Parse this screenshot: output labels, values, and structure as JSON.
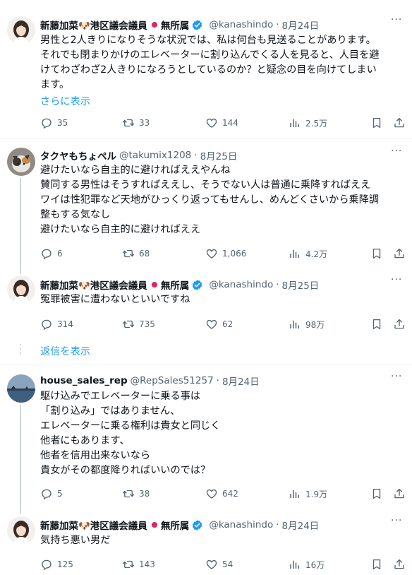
{
  "colors": {
    "accent": "#1d9bf0",
    "muted": "#536471",
    "text": "#0f1419",
    "verified": "#1d9bf0",
    "red_ball": "#e0245e"
  },
  "tweets": [
    {
      "name": "新藤加菜🐶港区議会議員",
      "affiliation": "無所属",
      "verified": true,
      "handle": "@kanashindo",
      "date": "8月24日",
      "lines": [
        "男性と2人きりになりそうな状況では、私は何台も見送ることがあります。",
        "それでも閉まりかけのエレベーターに割り込んでくる人を見ると、人目を避",
        "けてわざわざ2人きりになろうとしているのか？と疑念の目を向けてしまい",
        "ます。"
      ],
      "show_more": "さらに表示",
      "replies": "35",
      "retweets": "33",
      "likes": "144",
      "views": "2.5万"
    },
    {
      "name": "タクヤもちょペル",
      "handle": "@takumix1208",
      "date": "8月25日",
      "lines": [
        "避けたいなら自主的に避ければええやんね",
        "賛同する男性はそうすればええし、そうでない人は普通に乗降すればええ",
        "ワイは性犯罪など天地がひっくり返ってもせんし、めんどくさいから乗降調",
        "整もする気なし",
        "避けたいなら自主的に避ければええ"
      ],
      "replies": "6",
      "retweets": "68",
      "likes": "1,066",
      "views": "4.2万"
    },
    {
      "name": "新藤加菜🐶港区議会議員",
      "affiliation": "無所属",
      "verified": true,
      "handle": "@kanashindo",
      "date": "8月25日",
      "lines": [
        "冤罪被害に遭わないといいですね"
      ],
      "replies": "314",
      "retweets": "735",
      "likes": "62",
      "views": "98万"
    },
    {
      "name": "house_sales_rep",
      "handle": "@RepSales51257",
      "date": "8月24日",
      "lines": [
        "駆け込みでエレベーターに乗る事は",
        "「割り込み」ではありません、",
        "エレベーターに乗る権利は貴女と同じく",
        "他者にもあります、",
        "他者を信用出来ないなら",
        "貴女がその都度降りればいいのでは？"
      ],
      "replies": "5",
      "retweets": "38",
      "likes": "642",
      "views": "1.9万"
    },
    {
      "name": "新藤加菜🐶港区議会議員",
      "affiliation": "無所属",
      "verified": true,
      "handle": "@kanashindo",
      "date": "8月24日",
      "lines": [
        "気持ち悪い男だ"
      ],
      "replies": "125",
      "retweets": "143",
      "likes": "54",
      "views": "16万"
    }
  ],
  "show_replies": "返信を表示",
  "icons": [
    "reply-icon",
    "retweet-icon",
    "like-icon",
    "views-icon",
    "bookmark-icon",
    "share-icon",
    "more-icon",
    "verified-icon"
  ]
}
